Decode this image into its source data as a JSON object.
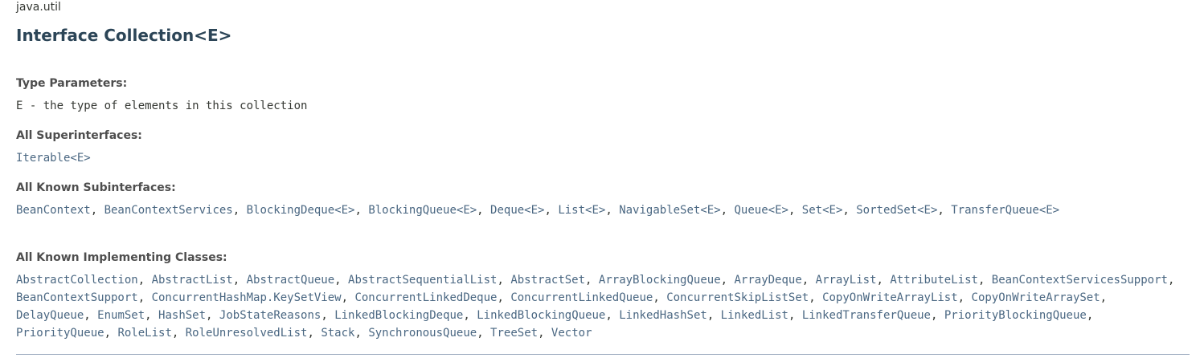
{
  "package": "java.util",
  "title": "Interface Collection<E>",
  "type_parameters": {
    "label": "Type Parameters:",
    "value": "E - the type of elements in this collection"
  },
  "superinterfaces": {
    "label": "All Superinterfaces:",
    "items": [
      "Iterable<E>"
    ]
  },
  "subinterfaces": {
    "label": "All Known Subinterfaces:",
    "items": [
      "BeanContext",
      "BeanContextServices",
      "BlockingDeque<E>",
      "BlockingQueue<E>",
      "Deque<E>",
      "List<E>",
      "NavigableSet<E>",
      "Queue<E>",
      "Set<E>",
      "SortedSet<E>",
      "TransferQueue<E>"
    ]
  },
  "implementing_classes": {
    "label": "All Known Implementing Classes:",
    "items": [
      "AbstractCollection",
      "AbstractList",
      "AbstractQueue",
      "AbstractSequentialList",
      "AbstractSet",
      "ArrayBlockingQueue",
      "ArrayDeque",
      "ArrayList",
      "AttributeList",
      "BeanContextServicesSupport",
      "BeanContextSupport",
      "ConcurrentHashMap.KeySetView",
      "ConcurrentLinkedDeque",
      "ConcurrentLinkedQueue",
      "ConcurrentSkipListSet",
      "CopyOnWriteArrayList",
      "CopyOnWriteArraySet",
      "DelayQueue",
      "EnumSet",
      "HashSet",
      "JobStateReasons",
      "LinkedBlockingDeque",
      "LinkedBlockingQueue",
      "LinkedHashSet",
      "LinkedList",
      "LinkedTransferQueue",
      "PriorityBlockingQueue",
      "PriorityQueue",
      "RoleList",
      "RoleUnresolvedList",
      "Stack",
      "SynchronousQueue",
      "TreeSet",
      "Vector"
    ]
  },
  "colors": {
    "title": "#2c4557",
    "link": "#4a6782",
    "text": "#353833",
    "rule": "#9eadc0"
  }
}
